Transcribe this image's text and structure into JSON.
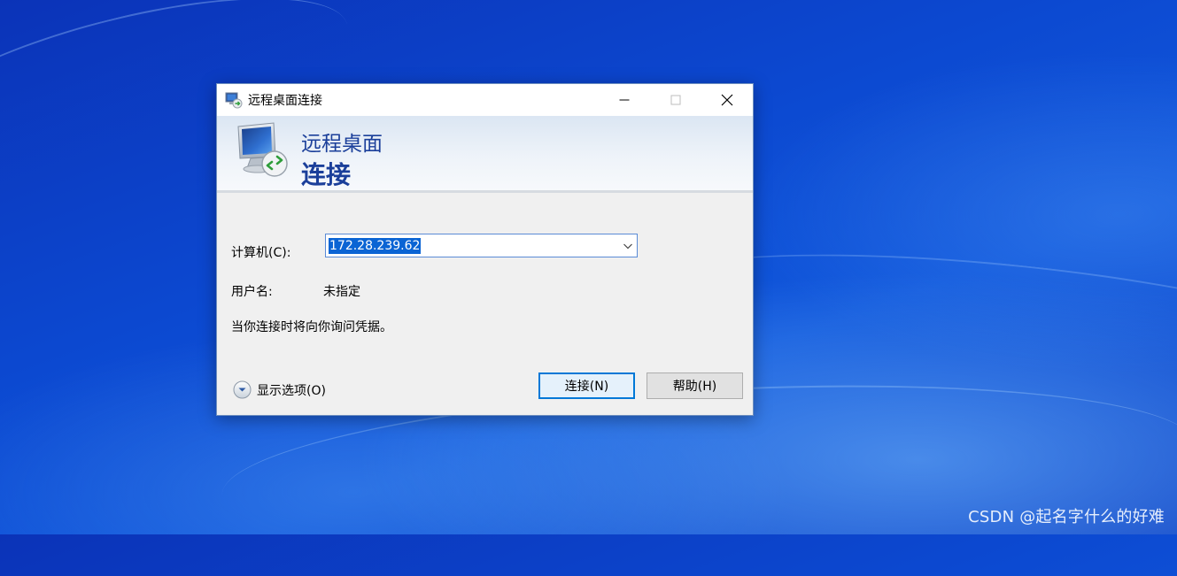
{
  "window": {
    "title": "远程桌面连接",
    "icon": "remote-desktop-icon",
    "controls": {
      "minimize": "minimize-icon",
      "maximize": "maximize-icon",
      "close": "close-icon"
    }
  },
  "banner": {
    "line1": "远程桌面",
    "line2": "连接"
  },
  "form": {
    "computer_label": "计算机(C):",
    "computer_value": "172.28.239.62",
    "username_label": "用户名:",
    "username_value": "未指定",
    "credentials_note": "当你连接时将向你询问凭据。"
  },
  "footer": {
    "show_options": "显示选项(O)",
    "connect_button": "连接(N)",
    "help_button": "帮助(H)"
  },
  "watermark": "CSDN @起名字什么的好难",
  "colors": {
    "accent": "#0078d7",
    "banner_text": "#1b3f9a",
    "selection": "#0a64d4"
  }
}
